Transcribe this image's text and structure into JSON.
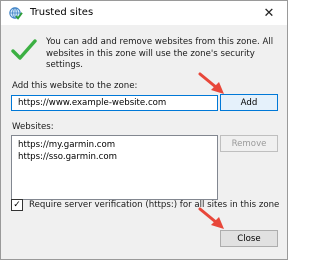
{
  "window": {
    "title": "Trusted sites",
    "close_glyph": "✕"
  },
  "intro_text": "You can add and remove websites from this zone. All websites in this zone will use the zone's security settings.",
  "add_section": {
    "label": "Add this website to the zone:",
    "input_value": "https://www.example-website.com",
    "add_button": "Add"
  },
  "websites_section": {
    "label": "Websites:",
    "items": [
      "https://my.garmin.com",
      "https://sso.garmin.com"
    ],
    "remove_button": "Remove"
  },
  "verification": {
    "checked": true,
    "checkmark": "✓",
    "label": "Require server verification (https:) for all sites in this zone"
  },
  "close_button": "Close",
  "colors": {
    "accent": "#0078d7",
    "annotation_arrow": "#e8473a",
    "checkmark_green": "#3cb043"
  },
  "icons": [
    "globe-check-icon",
    "green-checkmark-icon",
    "close-icon",
    "checkbox-check-icon",
    "red-arrow-annotation"
  ]
}
